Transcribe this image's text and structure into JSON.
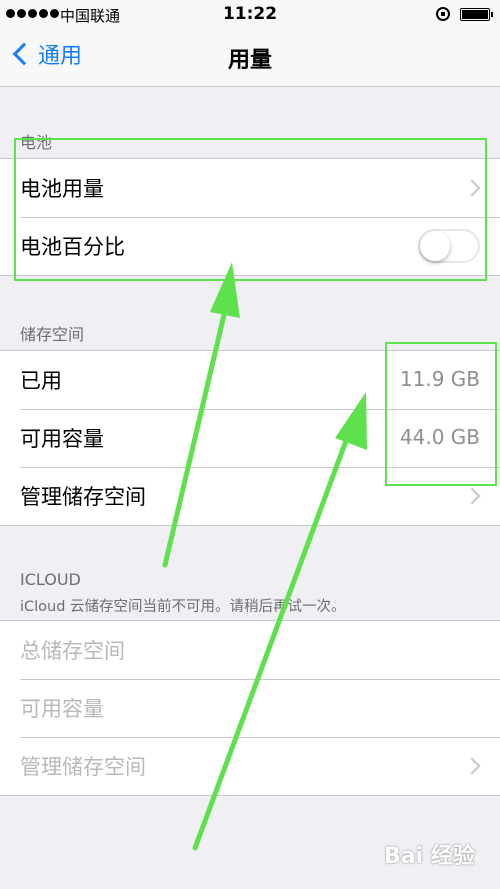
{
  "status": {
    "carrier": "中国联通",
    "time": "11:22",
    "signal_dots": 5
  },
  "nav": {
    "back_label": "通用",
    "title": "用量"
  },
  "battery_section": {
    "header": "电池",
    "rows": [
      {
        "label": "电池用量",
        "accessory": "chevron"
      },
      {
        "label": "电池百分比",
        "accessory": "toggle",
        "on": false
      }
    ]
  },
  "storage_section": {
    "header": "储存空间",
    "rows": [
      {
        "label": "已用",
        "value": "11.9 GB"
      },
      {
        "label": "可用容量",
        "value": "44.0 GB"
      },
      {
        "label": "管理储存空间",
        "accessory": "chevron"
      }
    ]
  },
  "icloud_section": {
    "header": "ICLOUD",
    "description": "iCloud 云储存空间当前不可用。请稍后再试一次。",
    "rows": [
      {
        "label": "总储存空间"
      },
      {
        "label": "可用容量"
      },
      {
        "label": "管理储存空间",
        "accessory": "chevron"
      }
    ]
  },
  "watermark": "Bai 经验",
  "colors": {
    "accent": "#147efb",
    "annotation": "#5fe04d",
    "background": "#efeff4"
  }
}
